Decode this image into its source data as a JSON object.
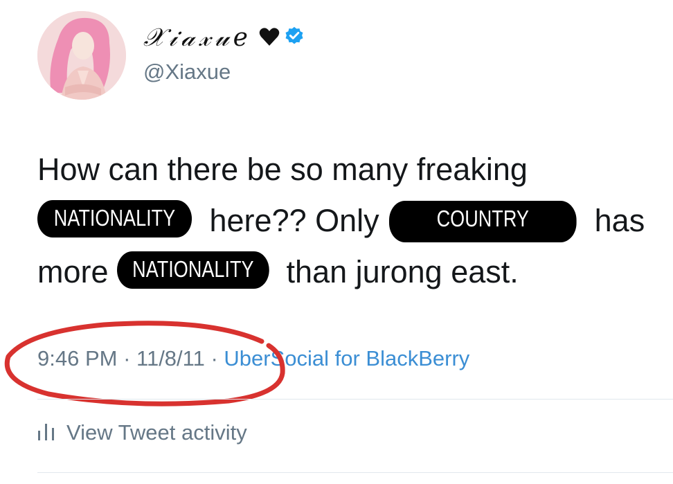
{
  "profile": {
    "display_name": "𝒳𝒾𝒶𝓍𝓊𝑒",
    "handle": "@Xiaxue",
    "verified": true
  },
  "tweet": {
    "line1": "How can there be so many freaking",
    "line2_redact": "NATIONALITY",
    "line2_mid": " here?? Only ",
    "line2_redact2": "COUNTRY",
    "line2_end": " has",
    "line3_start": "more ",
    "line3_redact": "NATIONALITY",
    "line3_end": " than jurong east."
  },
  "meta": {
    "time": "9:46 PM",
    "sep1": " · ",
    "date": "11/8/11",
    "sep2": " · ",
    "source": "UberSocial for BlackBerry"
  },
  "activity": {
    "label": "View Tweet activity"
  },
  "colors": {
    "secondary_text": "#657786",
    "link": "#3b8ed4",
    "verified_badge": "#1da1f2",
    "highlight_circle": "#d8322f",
    "redaction": "#000000"
  },
  "icons": [
    "heart-icon",
    "verified-icon",
    "bars-icon"
  ]
}
